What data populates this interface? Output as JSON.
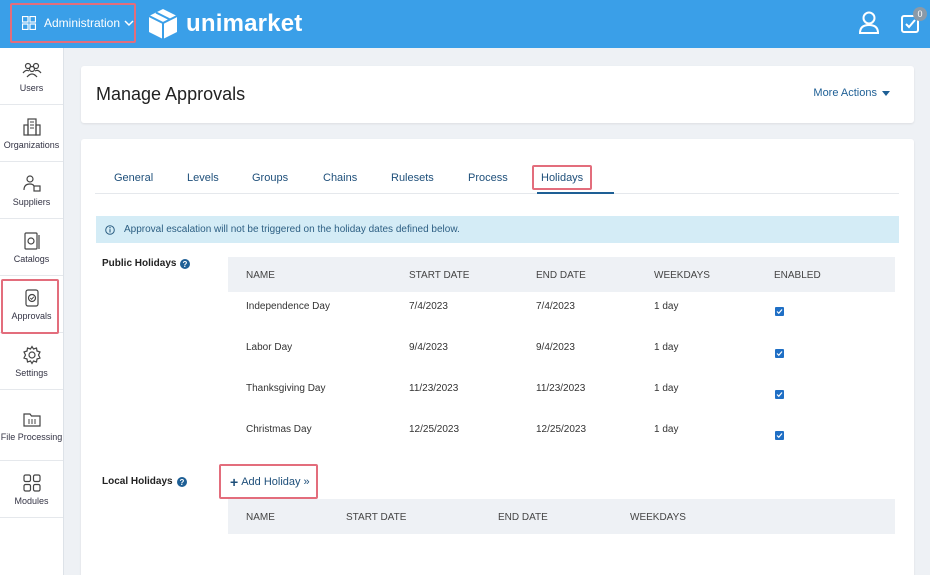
{
  "topbar": {
    "admin_label": "Administration",
    "brand": "unimarket",
    "cart_badge": "0"
  },
  "sidebar": {
    "items": [
      {
        "label": "Users",
        "icon": "users-icon"
      },
      {
        "label": "Organizations",
        "icon": "building-icon"
      },
      {
        "label": "Suppliers",
        "icon": "supplier-icon"
      },
      {
        "label": "Catalogs",
        "icon": "catalog-icon"
      },
      {
        "label": "Approvals",
        "icon": "approval-icon"
      },
      {
        "label": "Settings",
        "icon": "gear-icon"
      },
      {
        "label": "File Processing",
        "icon": "file-processing-icon"
      },
      {
        "label": "Modules",
        "icon": "modules-icon"
      }
    ]
  },
  "page": {
    "title": "Manage Approvals",
    "more_actions": "More Actions"
  },
  "tabs": [
    "General",
    "Levels",
    "Groups",
    "Chains",
    "Rulesets",
    "Process",
    "Holidays"
  ],
  "active_tab": "Holidays",
  "info_text": "Approval escalation will not be triggered on the holiday dates defined below.",
  "public_holidays": {
    "label": "Public Holidays",
    "columns": [
      "NAME",
      "START DATE",
      "END DATE",
      "WEEKDAYS",
      "ENABLED"
    ],
    "rows": [
      {
        "name": "Independence Day",
        "start": "7/4/2023",
        "end": "7/4/2023",
        "weekdays": "1 day",
        "enabled": true
      },
      {
        "name": "Labor Day",
        "start": "9/4/2023",
        "end": "9/4/2023",
        "weekdays": "1 day",
        "enabled": true
      },
      {
        "name": "Thanksgiving Day",
        "start": "11/23/2023",
        "end": "11/23/2023",
        "weekdays": "1 day",
        "enabled": true
      },
      {
        "name": "Christmas Day",
        "start": "12/25/2023",
        "end": "12/25/2023",
        "weekdays": "1 day",
        "enabled": true
      }
    ]
  },
  "local_holidays": {
    "label": "Local Holidays",
    "add_label": "Add Holiday »",
    "columns": [
      "NAME",
      "START DATE",
      "END DATE",
      "WEEKDAYS"
    ]
  },
  "colors": {
    "topbar": "#3a9fe8",
    "highlight": "#e36d7c",
    "link": "#1e5f95",
    "info_bg": "#d4ecf6"
  }
}
